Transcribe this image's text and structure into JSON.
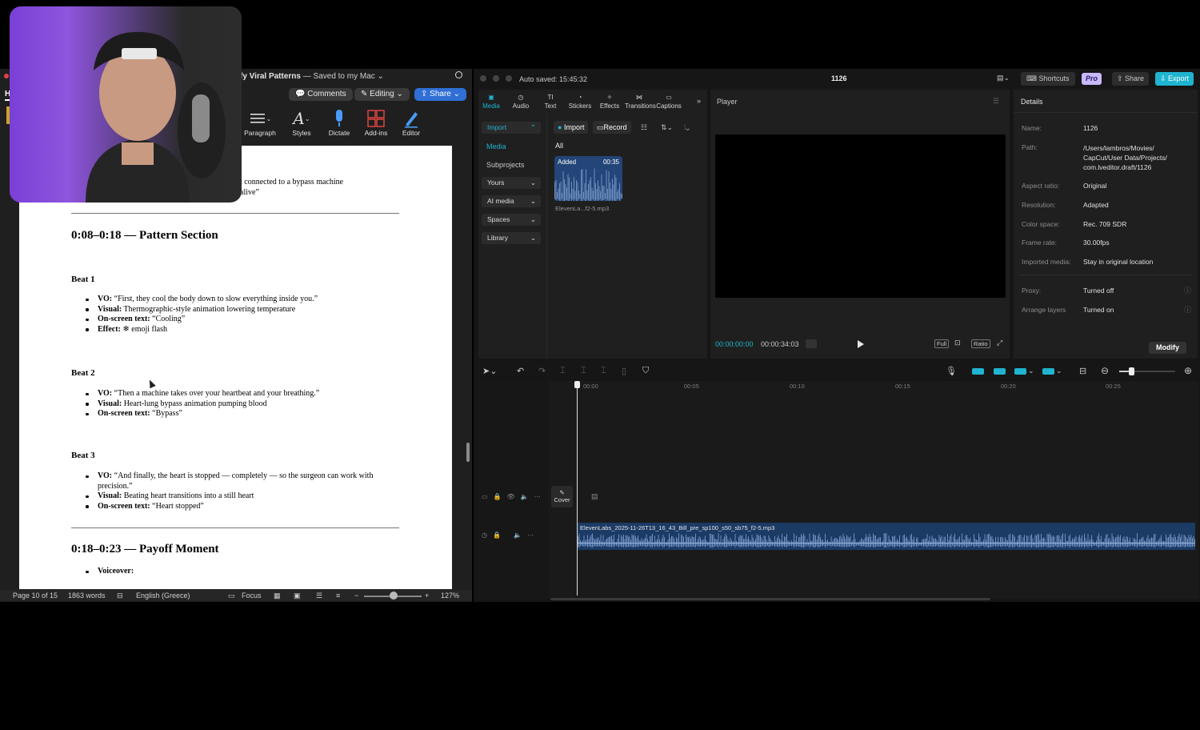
{
  "word": {
    "title_tail": "fy Viral Patterns",
    "title_saved": " — Saved to my Mac",
    "ribbon_tab_initial": "H",
    "buttons": {
      "comments": "Comments",
      "editing": "Editing",
      "share": "Share"
    },
    "ribbon": [
      {
        "label": "Paragraph",
        "icon": "paragraph-icon"
      },
      {
        "label": "Styles",
        "icon": "styles-icon"
      },
      {
        "label": "Dictate",
        "icon": "microphone-icon"
      },
      {
        "label": "Add-ins",
        "icon": "add-ins-icon"
      },
      {
        "label": "Editor",
        "icon": "editor-pen-icon"
      }
    ],
    "doc": {
      "partial_line_1": "t connected to a bypass machine",
      "partial_line_2": "alive”",
      "section1_title": "0:08–0:18 — Pattern Section",
      "beats": [
        {
          "title": "Beat 1",
          "items": [
            {
              "label": "VO:",
              "text": " “First, they cool the body down to slow everything inside you.”"
            },
            {
              "label": "Visual:",
              "text": " Thermographic-style animation lowering temperature"
            },
            {
              "label": "On-screen text:",
              "text": " “Cooling”"
            },
            {
              "label": "Effect:",
              "text": " ❄ emoji flash"
            }
          ]
        },
        {
          "title": "Beat 2",
          "items": [
            {
              "label": "VO:",
              "text": " “Then a machine takes over your heartbeat and your breathing.”"
            },
            {
              "label": "Visual:",
              "text": " Heart-lung bypass animation pumping blood"
            },
            {
              "label": "On-screen text:",
              "text": " “Bypass”"
            }
          ]
        },
        {
          "title": "Beat 3",
          "items": [
            {
              "label": "VO:",
              "text": " “And finally, the heart is stopped — completely — so the surgeon can work with precision.”"
            },
            {
              "label": "Visual:",
              "text": " Beating heart transitions into a still heart"
            },
            {
              "label": "On-screen text:",
              "text": " “Heart stopped”"
            }
          ]
        }
      ],
      "section2_title": "0:18–0:23 — Payoff Moment",
      "section2_items": [
        {
          "label": "Voiceover:",
          "text": ""
        }
      ]
    },
    "status": {
      "page": "Page 10 of 15",
      "words": "1863 words",
      "language": "English (Greece)",
      "focus": "Focus",
      "zoom": "127%",
      "zoom_level": 0.52
    }
  },
  "capcut": {
    "autosave": "Auto saved: 15:45:32",
    "project": "1126",
    "top_buttons": {
      "shortcuts": "Shortcuts",
      "pro": "Pro",
      "share": "Share",
      "export": "Export"
    },
    "tools": [
      {
        "label": "Media",
        "icon": "media-icon",
        "active": true
      },
      {
        "label": "Audio",
        "icon": "audio-icon"
      },
      {
        "label": "Text",
        "icon": "text-icon"
      },
      {
        "label": "Stickers",
        "icon": "stickers-icon"
      },
      {
        "label": "Effects",
        "icon": "effects-icon"
      },
      {
        "label": "Transitions",
        "icon": "transitions-icon"
      },
      {
        "label": "Captions",
        "icon": "captions-icon"
      }
    ],
    "nav": {
      "import": "Import",
      "media": "Media",
      "subprojects": "Subprojects",
      "yours": "Yours",
      "ai_media": "AI media",
      "spaces": "Spaces",
      "library": "Library"
    },
    "media": {
      "import_btn": "Import",
      "record_btn": "Record",
      "filter_all": "All",
      "clip_badge": "Added",
      "clip_duration": "00:35",
      "clip_name": "ElevenLa...f2-5.mp3"
    },
    "player": {
      "title": "Player",
      "time_current": "00:00:00:00",
      "time_total": "00:00:34:03",
      "btn_full": "Full",
      "btn_ratio": "Ratio"
    },
    "details": {
      "title": "Details",
      "rows": [
        {
          "key": "Name:",
          "value": "1126"
        },
        {
          "key": "Path:",
          "value": "/Users/lambros/Movies/ CapCut/User Data/Projects/ com.lveditor.draft/1126"
        },
        {
          "key": "Aspect ratio:",
          "value": "Original"
        },
        {
          "key": "Resolution:",
          "value": "Adapted"
        },
        {
          "key": "Color space:",
          "value": "Rec. 709 SDR"
        },
        {
          "key": "Frame rate:",
          "value": "30.00fps"
        },
        {
          "key": "Imported media:",
          "value": "Stay in original location"
        },
        {
          "key": "Proxy:",
          "value": "Turned off"
        },
        {
          "key": "Arrange layers",
          "value": "Turned on"
        }
      ],
      "modify": "Modify"
    },
    "timeline": {
      "ruler": [
        "00:00",
        "00:05",
        "00:10",
        "00:15",
        "00:20",
        "00:25"
      ],
      "cover": "Cover",
      "audio_clip": "ElevenLabs_2025-11-26T13_16_43_Bill_pre_sp100_s50_sb75_f2-5.mp3"
    }
  },
  "colors": {
    "accent_cyan": "#1fb5d0",
    "word_blue": "#2f6fd6",
    "audio_clip": "#1b3a64",
    "pro_badge": "#c9b8ff"
  }
}
